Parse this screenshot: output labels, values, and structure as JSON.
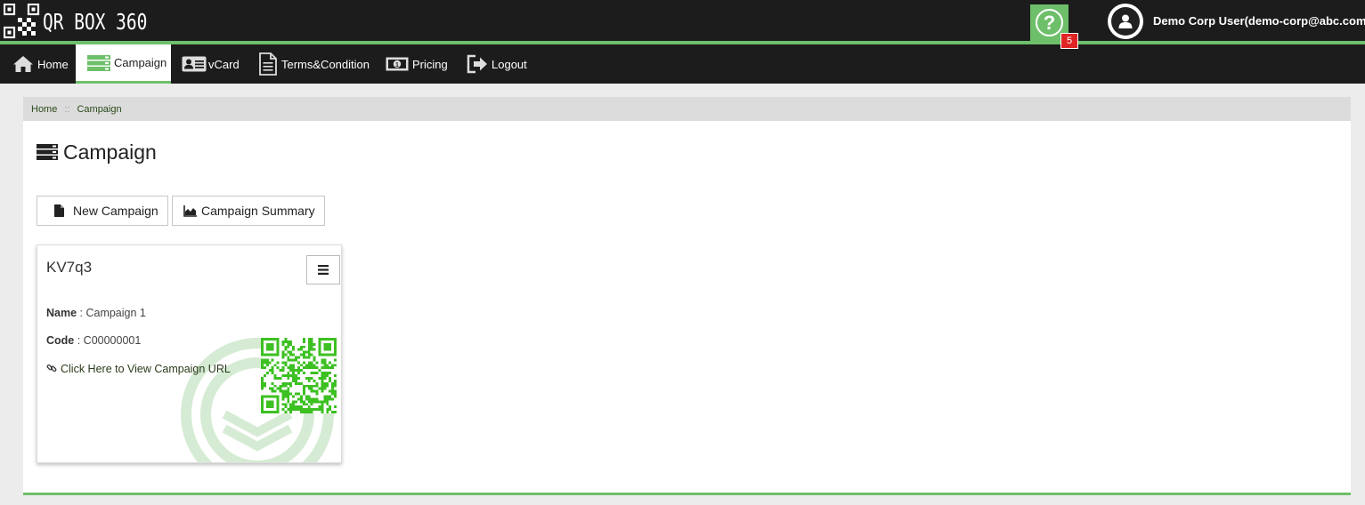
{
  "app": {
    "logo_text": "QR BOX 360",
    "help_badge": "5",
    "user_label": "Demo Corp User(demo-corp@abc.com)",
    "accent_color": "#6ebf6a"
  },
  "nav": {
    "items": [
      {
        "label": "Home",
        "icon": "home-icon"
      },
      {
        "label": "Campaign",
        "icon": "campaign-list-icon",
        "active": true
      },
      {
        "label": "vCard",
        "icon": "vcard-icon"
      },
      {
        "label": "Terms&Condition",
        "icon": "document-icon"
      },
      {
        "label": "Pricing",
        "icon": "money-icon"
      },
      {
        "label": "Logout",
        "icon": "logout-icon"
      }
    ]
  },
  "breadcrumb": {
    "home": "Home",
    "separator": "::",
    "current": "Campaign"
  },
  "page": {
    "title": "Campaign",
    "new_campaign_label": "New Campaign",
    "summary_label": "Campaign Summary"
  },
  "card": {
    "title": "KV7q3",
    "name_label": "Name",
    "name_value": "Campaign 1",
    "code_label": "Code",
    "code_value": "C00000001",
    "link_text": "Click Here to View Campaign URL"
  }
}
